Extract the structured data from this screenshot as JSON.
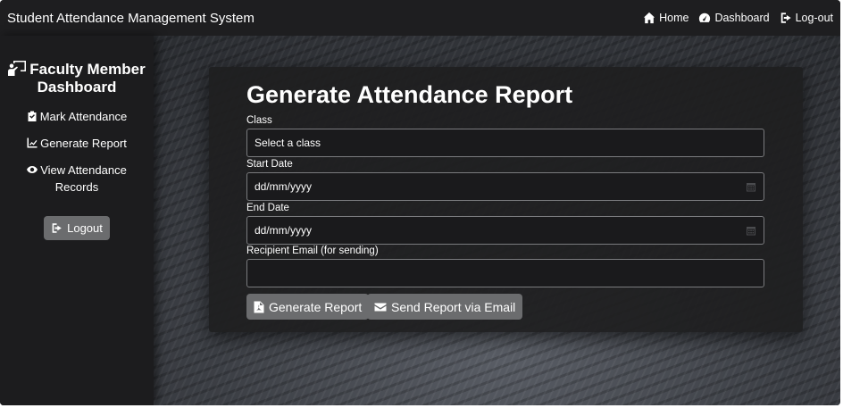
{
  "navbar": {
    "brand": "Student Attendance Management System",
    "links": [
      {
        "label": "Home",
        "icon": "home-icon"
      },
      {
        "label": "Dashboard",
        "icon": "dashboard-icon"
      },
      {
        "label": "Log-out",
        "icon": "sign-out-icon"
      }
    ]
  },
  "sidebar": {
    "title": "Faculty Member Dashboard",
    "title_icon": "teacher-icon",
    "items": [
      {
        "label": "Mark Attendance",
        "icon": "clipboard-icon"
      },
      {
        "label": "Generate Report",
        "icon": "chart-line-icon"
      },
      {
        "label": "View Attendance Records",
        "icon": "eye-icon"
      }
    ],
    "logout_label": "Logout"
  },
  "form": {
    "title": "Generate Attendance Report",
    "class_label": "Class",
    "class_value": "Select a class",
    "start_label": "Start Date",
    "start_value": "dd/mm/yyyy",
    "end_label": "End Date",
    "end_value": "dd/mm/yyyy",
    "email_label": "Recipient Email (for sending)",
    "email_value": "",
    "generate_label": "Generate Report",
    "send_label": "Send Report via Email"
  },
  "colors": {
    "navbar_bg": "#1e1e20",
    "sidebar_bg": "#1c1c1e",
    "button_bg": "#6b6c6e",
    "text": "#ffffff"
  }
}
